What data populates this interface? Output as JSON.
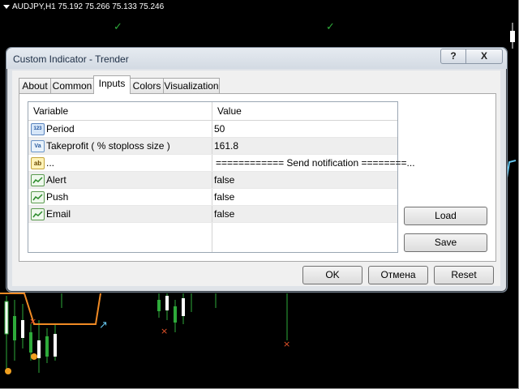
{
  "chart": {
    "header": "AUDJPY,H1  75.192 75.266 75.133 75.246"
  },
  "dialog": {
    "title": "Custom Indicator - Trender",
    "help_label": "?",
    "close_label": "X",
    "tabs": [
      "About",
      "Common",
      "Inputs",
      "Colors",
      "Visualization"
    ],
    "active_tab": "Inputs",
    "table": {
      "headers": [
        "Variable",
        "Value"
      ],
      "rows": [
        {
          "icon": "123",
          "variable": "Period",
          "value": "50"
        },
        {
          "icon": "Va",
          "variable": "Takeprofit ( % stoploss size )",
          "value": "161.8"
        },
        {
          "icon": "ab",
          "variable": "...",
          "value": "============ Send notification ========..."
        },
        {
          "icon": "bool-icon",
          "variable": "Alert",
          "value": "false"
        },
        {
          "icon": "bool-icon",
          "variable": "Push",
          "value": "false"
        },
        {
          "icon": "bool-icon",
          "variable": "Email",
          "value": "false"
        }
      ]
    },
    "load_label": "Load",
    "save_label": "Save",
    "ok_label": "OK",
    "cancel_label": "Отмена",
    "reset_label": "Reset"
  }
}
